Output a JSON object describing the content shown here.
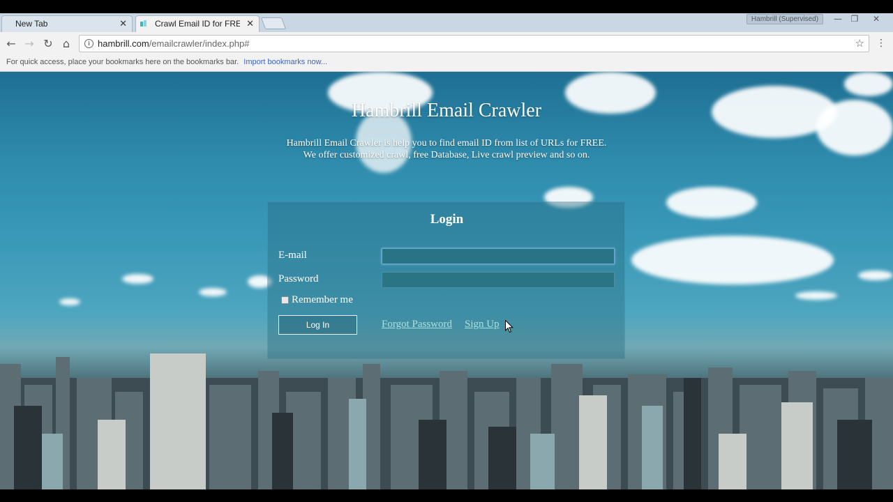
{
  "browser": {
    "tabs": [
      {
        "title": "New Tab",
        "active": false
      },
      {
        "title": "Crawl Email ID for FREE f",
        "active": true
      }
    ],
    "profile_label": "Hambrill (Supervised)",
    "address": {
      "host": "hambrill.com",
      "path": "/emailcrawler/index.php#"
    },
    "bookmarks_bar": {
      "message": "For quick access, place your bookmarks here on the bookmarks bar.",
      "link": "Import bookmarks now..."
    }
  },
  "page": {
    "title": "Hambrill Email Crawler",
    "description_line1": "Hambrill Email Crawler is help you to find email ID from list of URLs for FREE.",
    "description_line2": "We offer customized crawl, free Database, Live crawl preview and so on.",
    "login": {
      "heading": "Login",
      "email_label": "E-mail",
      "email_value": "",
      "password_label": "Password",
      "password_value": "",
      "remember_label": "Remember me",
      "remember_checked": false,
      "login_button": "Log In",
      "forgot_link": "Forgot Password",
      "signup_link": "Sign Up"
    }
  },
  "colors": {
    "tab_strip": "#c9d6e3",
    "toolbar": "#f2f2f2",
    "link": "#a8e0e0",
    "bookmark_link": "#3b64c4"
  }
}
